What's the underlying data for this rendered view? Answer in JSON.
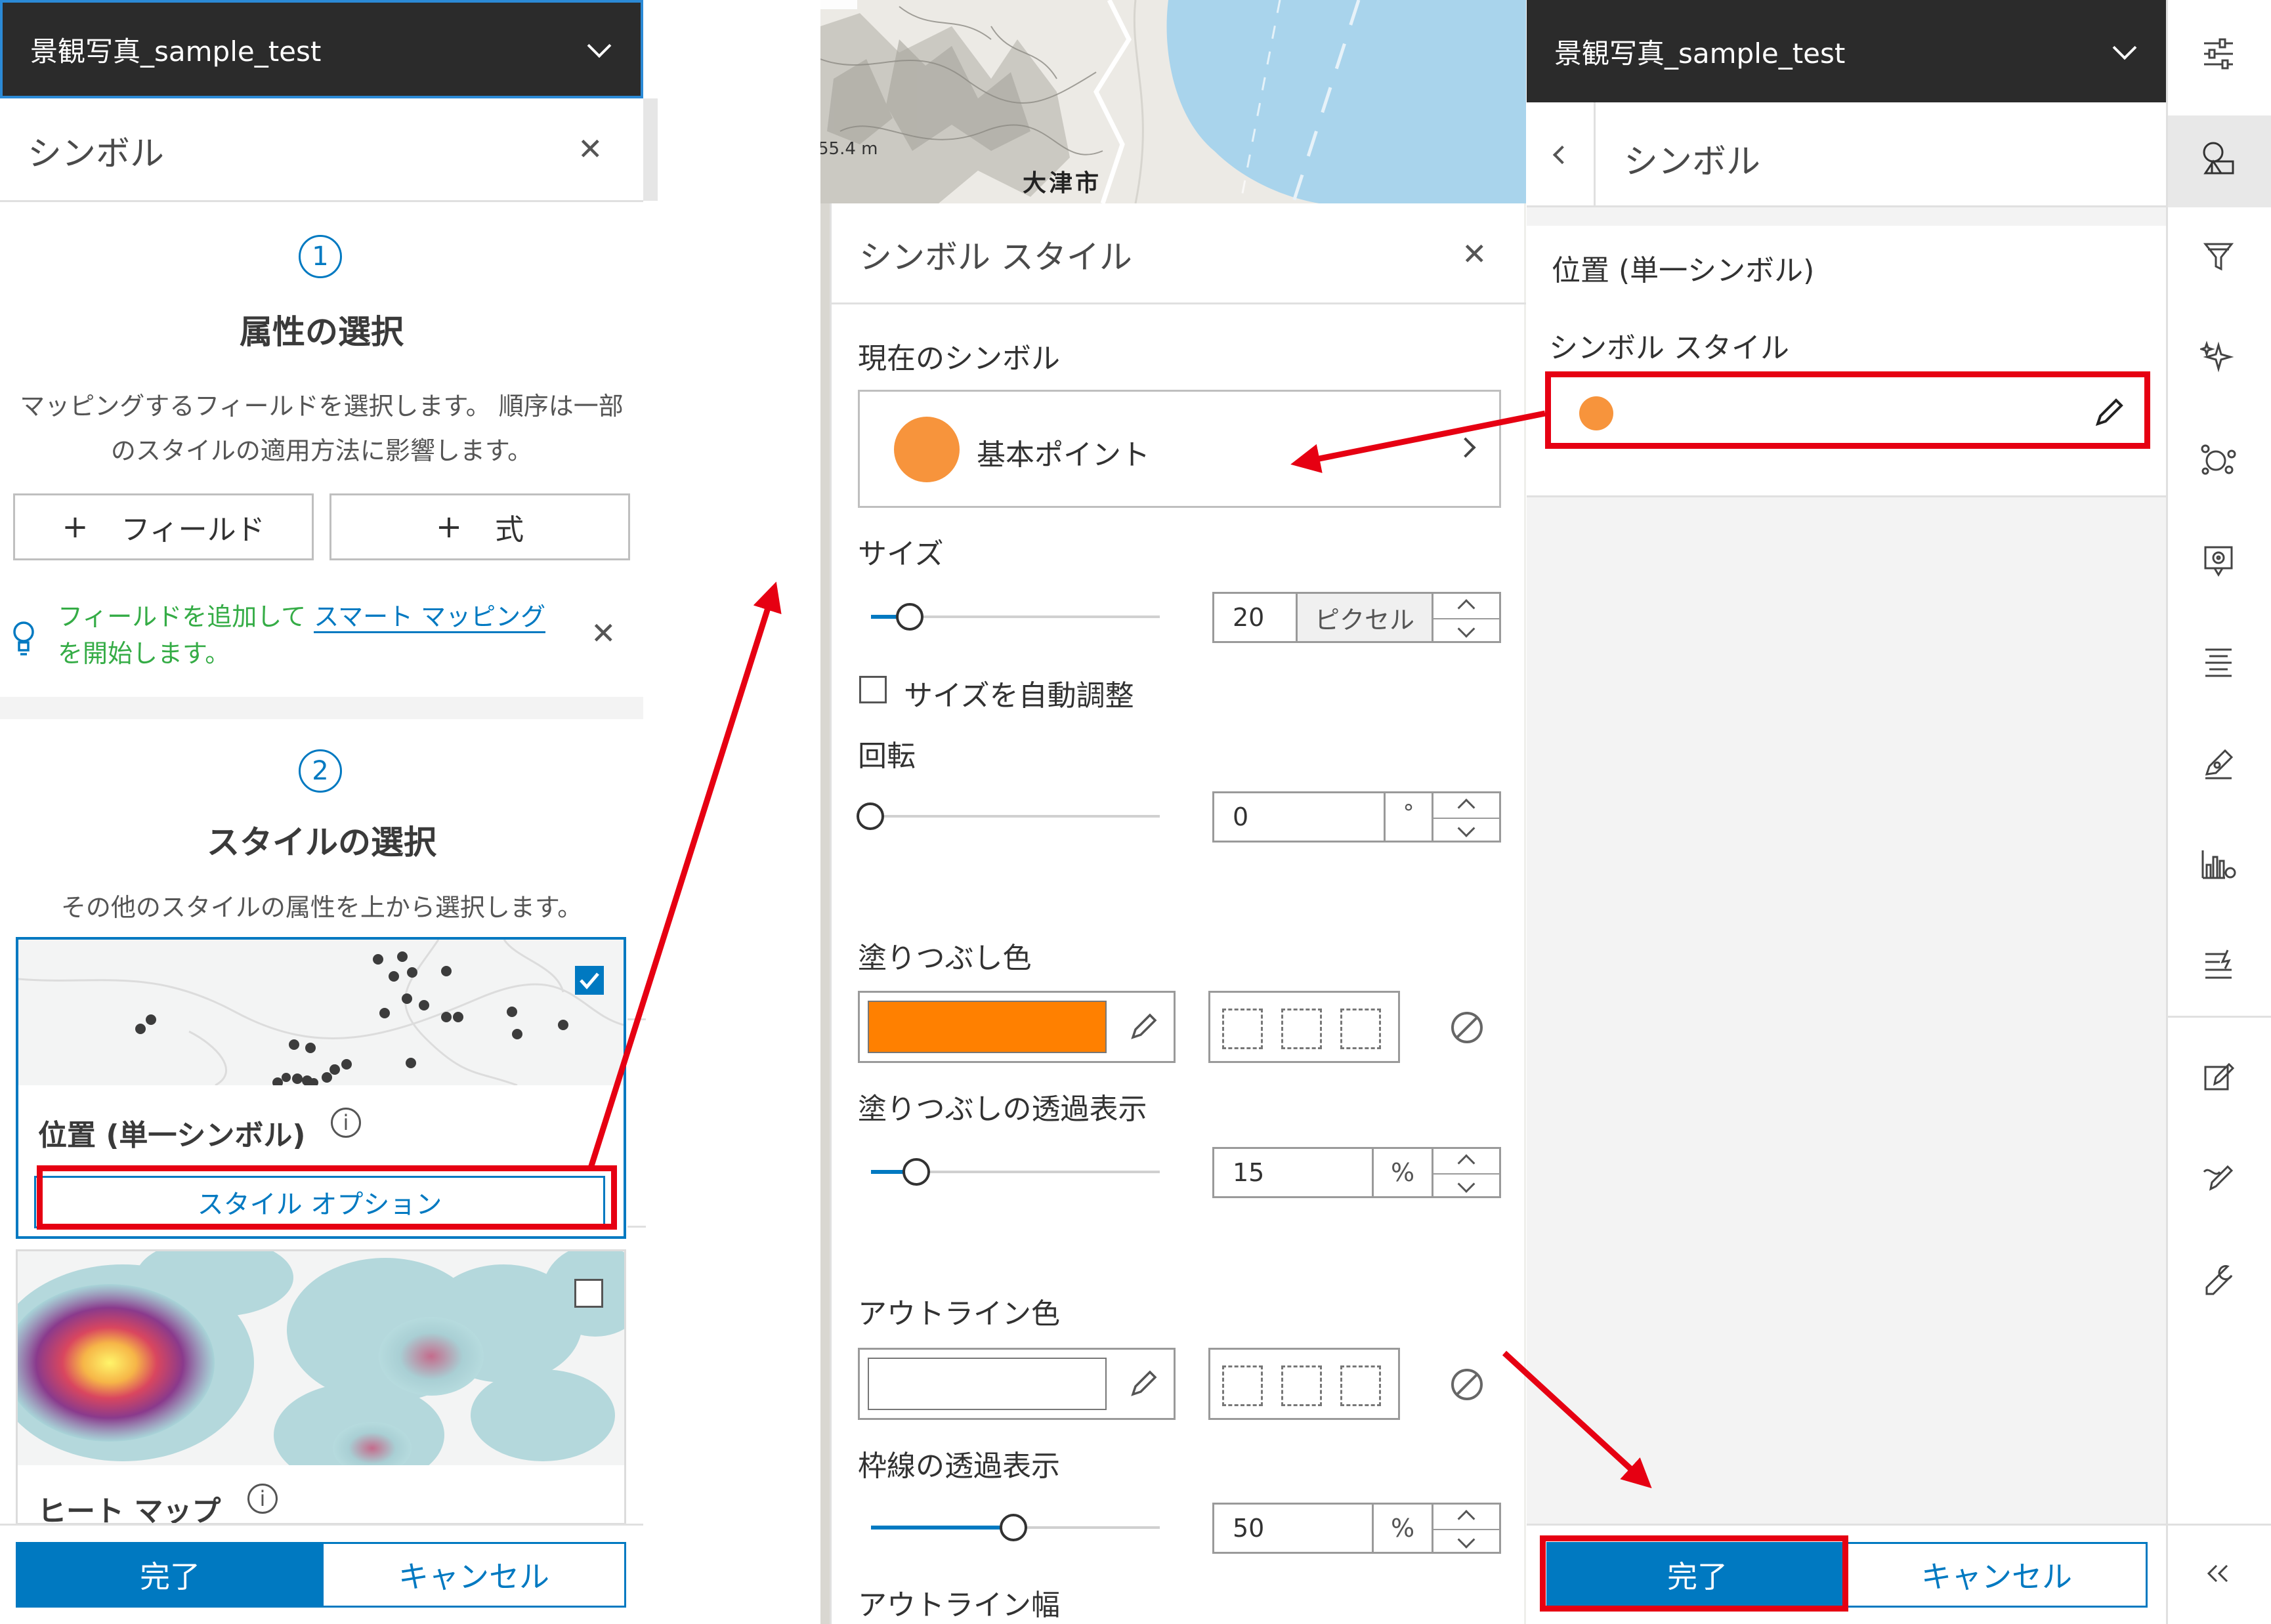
{
  "left_panel": {
    "layer_name": "景観写真_sample_test",
    "title": "シンボル",
    "step1_number": "1",
    "step1_title": "属性の選択",
    "step1_desc_line1": "マッピングするフィールドを選択します。 順序は一部",
    "step1_desc_line2": "のスタイルの適用方法に影響します。",
    "add_field_label": "フィールド",
    "add_expression_label": "式",
    "plus": "+",
    "tip_text1": "フィールドを追加して",
    "tip_link": "スマート マッピング",
    "tip_text2": "を開始します。",
    "step2_number": "2",
    "step2_title": "スタイルの選択",
    "step2_desc": "その他のスタイルの属性を上から選択します。",
    "style1_name": "位置 (単一シンボル)",
    "style1_options": "スタイル オプション",
    "style2_name": "ヒート マップ",
    "done": "完了",
    "cancel": "キャンセル"
  },
  "map": {
    "elevation": "55.4 m",
    "city": "大津市"
  },
  "symbol_style_panel": {
    "title": "シンボル スタイル",
    "current_symbol_label": "現在のシンボル",
    "current_symbol_name": "基本ポイント",
    "size_label": "サイズ",
    "size_value": "20",
    "size_unit": "ピクセル",
    "size_slider_fraction": 0.05,
    "auto_size_label": "サイズを自動調整",
    "auto_size_checked": false,
    "rotation_label": "回転",
    "rotation_value": "0",
    "rotation_unit": "°",
    "fill_color_label": "塗りつぶし色",
    "fill_color": "#ff8000",
    "fill_transparency_label": "塗りつぶしの透過表示",
    "fill_transparency_value": "15",
    "percent": "%",
    "outline_color_label": "アウトライン色",
    "outline_color": "#ffffff",
    "outline_transparency_label": "枠線の透過表示",
    "outline_transparency_value": "50",
    "outline_width_label": "アウトライン幅"
  },
  "right_panel": {
    "layer_name": "景観写真_sample_test",
    "title": "シンボル",
    "style_name": "位置 (単一シンボル)",
    "symbol_style_label": "シンボル スタイル",
    "symbol_color": "#f7943c",
    "done": "完了",
    "cancel": "キャンセル"
  },
  "colors": {
    "accent": "#0079c1",
    "highlight_red": "#e60012",
    "header_dark": "#2b2b2b"
  },
  "icons": [
    "properties-icon",
    "styles-icon",
    "filter-icon",
    "effects-icon",
    "clustering-icon",
    "popup-icon",
    "labels-icon",
    "forms-icon",
    "charts-icon",
    "configure-icon",
    "edit-icon",
    "sketch-icon",
    "tools-icon",
    "collapse-icon"
  ]
}
